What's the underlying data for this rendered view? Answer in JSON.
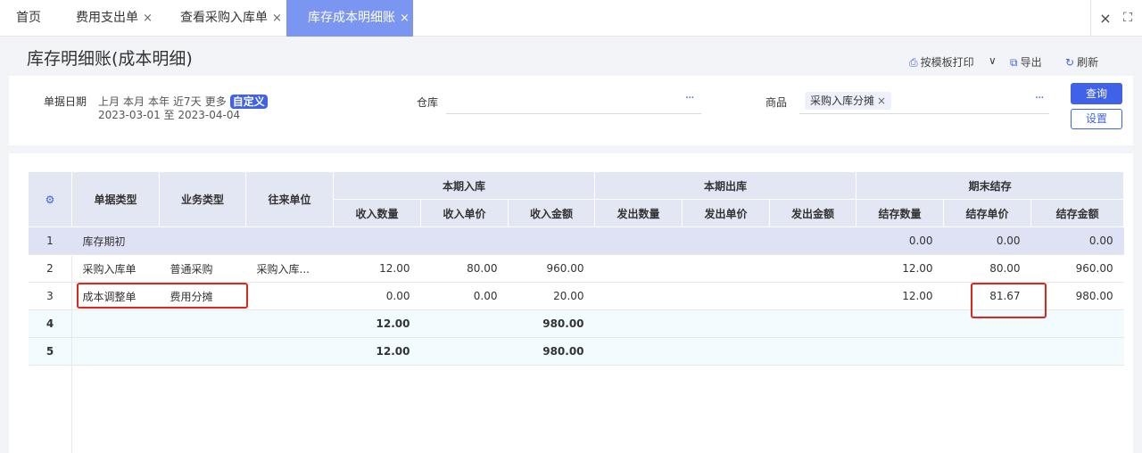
{
  "tabs": [
    {
      "label": "首页",
      "closable": false,
      "active": false
    },
    {
      "label": "费用支出单",
      "closable": true,
      "active": false
    },
    {
      "label": "查看采购入库单",
      "closable": true,
      "active": false
    },
    {
      "label": "库存成本明细账",
      "closable": true,
      "active": true
    }
  ],
  "tab_close_glyph": "×",
  "window": {
    "close_glyph": "×",
    "fullscreen_glyph": "⛶"
  },
  "page": {
    "title": "库存明细账(成本明细)"
  },
  "actions": {
    "print": "按模板打印",
    "print_icon": "⎙",
    "dropdown": "∨",
    "export": "导出",
    "export_icon": "⧉",
    "refresh": "刷新",
    "refresh_icon": "↻"
  },
  "filters": {
    "date_label": "单据日期",
    "quick": [
      "上月",
      "本月",
      "本年",
      "近7天",
      "更多"
    ],
    "custom": "自定义",
    "date_range": "2023-03-01 至 2023-04-04",
    "warehouse_label": "仓库",
    "product_label": "商品",
    "product_tag": "采购入库分摊",
    "more_glyph": "···",
    "query": "查询",
    "settings": "设置"
  },
  "table": {
    "settings_icon": "⚙",
    "headers": {
      "doc_type": "单据类型",
      "biz_type": "业务类型",
      "partner": "往来单位",
      "in_group": "本期入库",
      "out_group": "本期出库",
      "end_group": "期末结存",
      "in_qty": "收入数量",
      "in_price": "收入单价",
      "in_amt": "收入金额",
      "out_qty": "发出数量",
      "out_price": "发出单价",
      "out_amt": "发出金额",
      "end_qty": "结存数量",
      "end_price": "结存单价",
      "end_amt": "结存金额"
    },
    "rows": [
      {
        "idx": "1",
        "doc_type": "库存期初",
        "biz_type": "",
        "partner": "",
        "in_qty": "",
        "in_price": "",
        "in_amt": "",
        "out_qty": "",
        "out_price": "",
        "out_amt": "",
        "end_qty": "0.00",
        "end_price": "0.00",
        "end_amt": "0.00"
      },
      {
        "idx": "2",
        "doc_type": "采购入库单",
        "biz_type": "普通采购",
        "partner": "采购入库...",
        "in_qty": "12.00",
        "in_price": "80.00",
        "in_amt": "960.00",
        "out_qty": "",
        "out_price": "",
        "out_amt": "",
        "end_qty": "12.00",
        "end_price": "80.00",
        "end_amt": "960.00"
      },
      {
        "idx": "3",
        "doc_type": "成本调整单",
        "biz_type": "费用分摊",
        "partner": "",
        "in_qty": "0.00",
        "in_price": "0.00",
        "in_amt": "20.00",
        "out_qty": "",
        "out_price": "",
        "out_amt": "",
        "end_qty": "12.00",
        "end_price": "81.67",
        "end_amt": "980.00"
      },
      {
        "idx": "4",
        "doc_type": "",
        "biz_type": "",
        "partner": "",
        "in_qty": "12.00",
        "in_price": "",
        "in_amt": "980.00",
        "out_qty": "",
        "out_price": "",
        "out_amt": "",
        "end_qty": "",
        "end_price": "",
        "end_amt": ""
      },
      {
        "idx": "5",
        "doc_type": "",
        "biz_type": "",
        "partner": "",
        "in_qty": "12.00",
        "in_price": "",
        "in_amt": "980.00",
        "out_qty": "",
        "out_price": "",
        "out_amt": "",
        "end_qty": "",
        "end_price": "",
        "end_amt": ""
      }
    ]
  },
  "colors": {
    "accent": "#3f62e8",
    "active_tab": "#7b96f0",
    "highlight": "#e0251b"
  }
}
